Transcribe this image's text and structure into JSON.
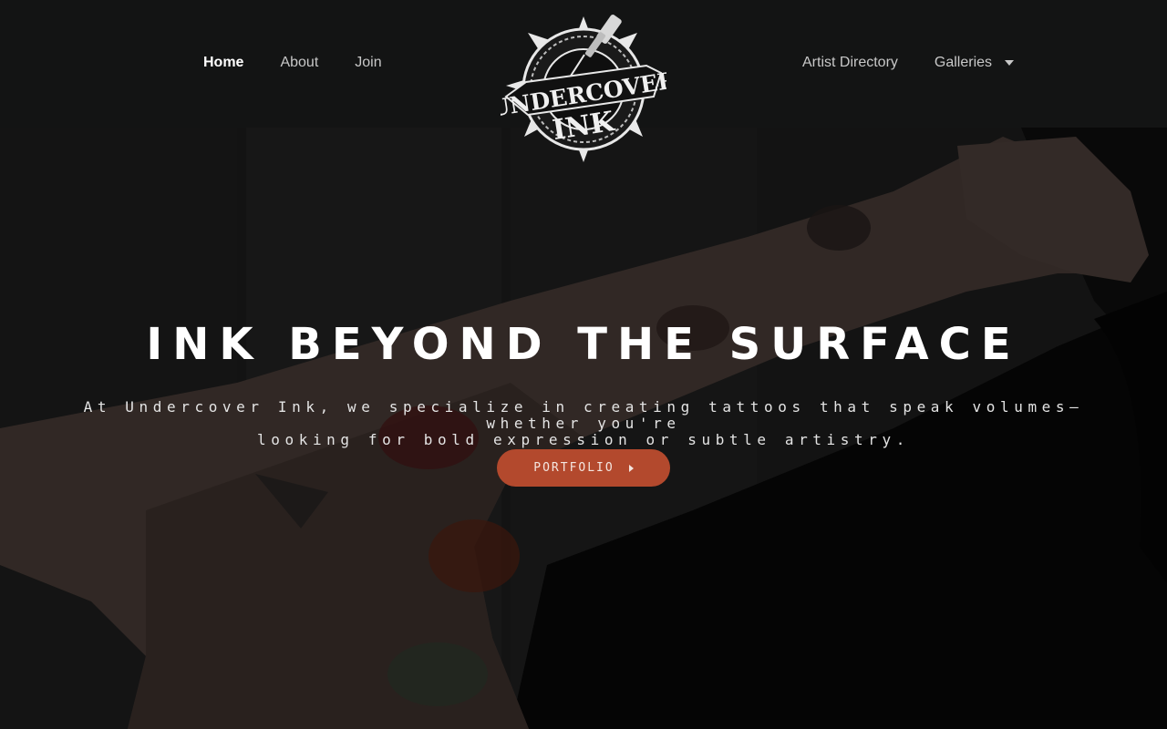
{
  "nav": {
    "left": [
      {
        "label": "Home",
        "active": true
      },
      {
        "label": "About",
        "active": false
      },
      {
        "label": "Join",
        "active": false
      }
    ],
    "right": [
      {
        "label": "Artist Directory"
      },
      {
        "label": "Galleries",
        "has_dropdown": true
      }
    ]
  },
  "logo": {
    "line1": "UNDERCOVER",
    "line2": "INK"
  },
  "hero": {
    "headline": "INK BEYOND THE SURFACE",
    "tagline_line1": "At Undercover Ink, we specialize in creating tattoos that speak volumes—whether you're",
    "tagline_line2": "looking for bold expression or subtle artistry.",
    "cta_label": "PORTFOLIO"
  },
  "colors": {
    "header_bg": "#131414",
    "accent": "#b3492d",
    "text_primary": "#ffffff"
  },
  "icons": {
    "dropdown": "chevron-down-icon",
    "cta_arrow": "play-arrow-icon"
  }
}
